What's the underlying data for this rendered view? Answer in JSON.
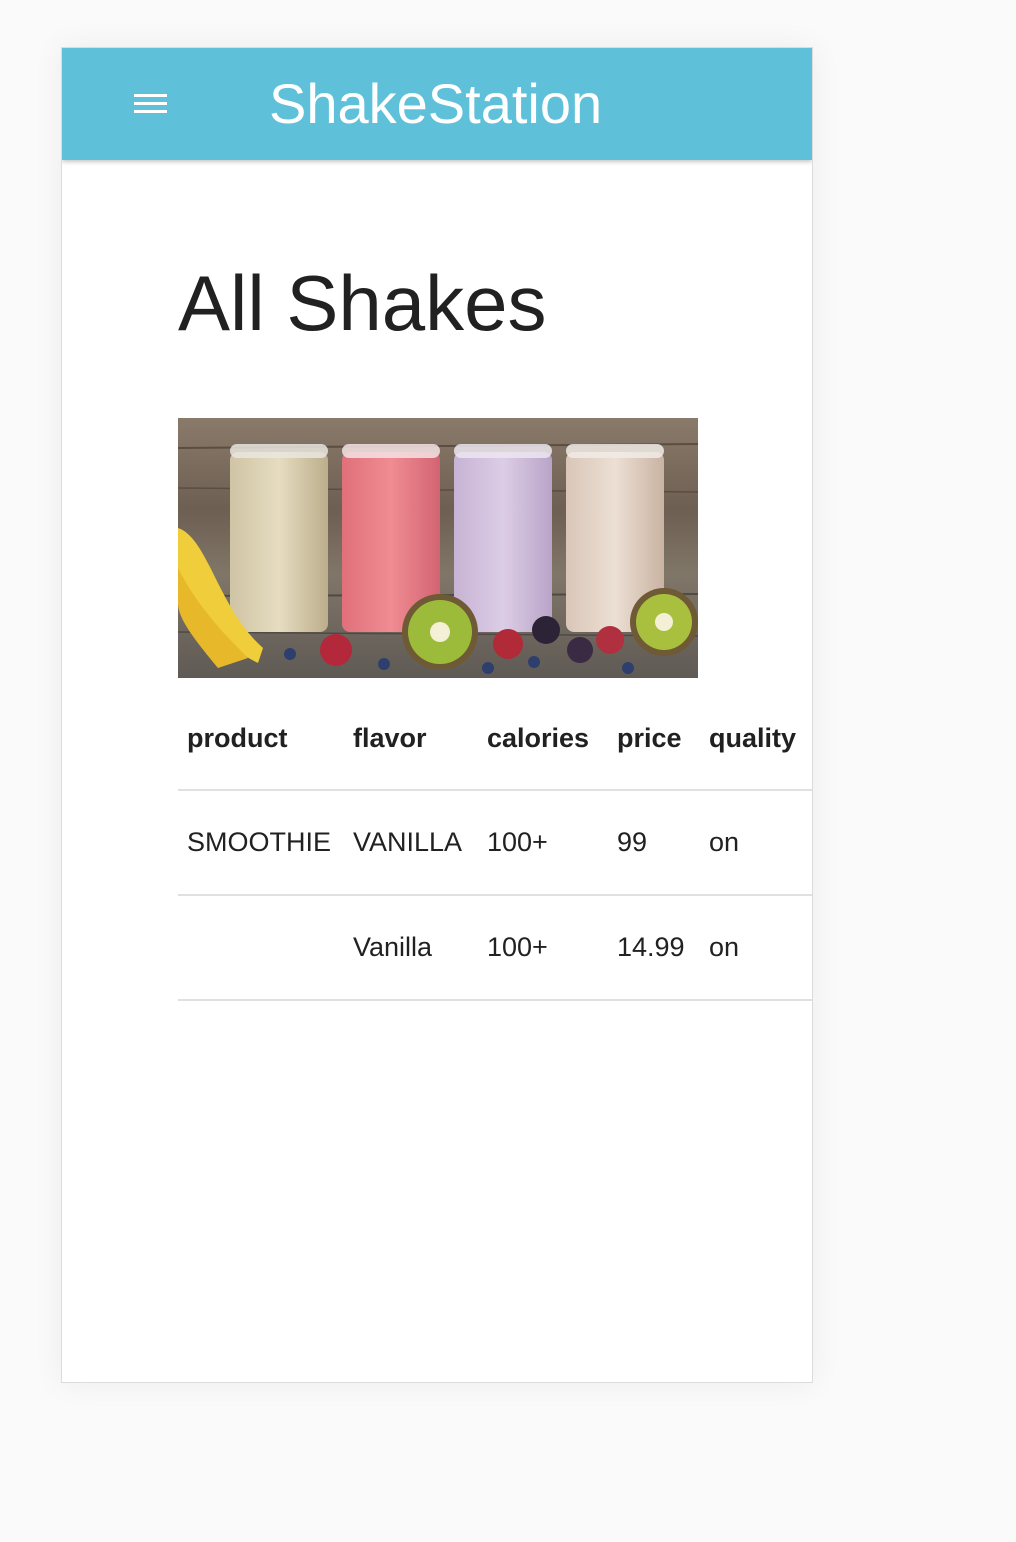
{
  "app": {
    "title": "ShakeStation",
    "menu_icon": "hamburger-menu-icon",
    "accent_color": "#5fc1d9"
  },
  "page": {
    "title": "All Shakes"
  },
  "table": {
    "columns": [
      "product",
      "flavor",
      "calories",
      "price",
      "quality"
    ],
    "rows": [
      [
        "SMOOTHIE",
        "VANILLA",
        "100+",
        "99",
        "on"
      ],
      [
        "",
        "Vanilla",
        "100+",
        "14.99",
        "on"
      ]
    ]
  }
}
